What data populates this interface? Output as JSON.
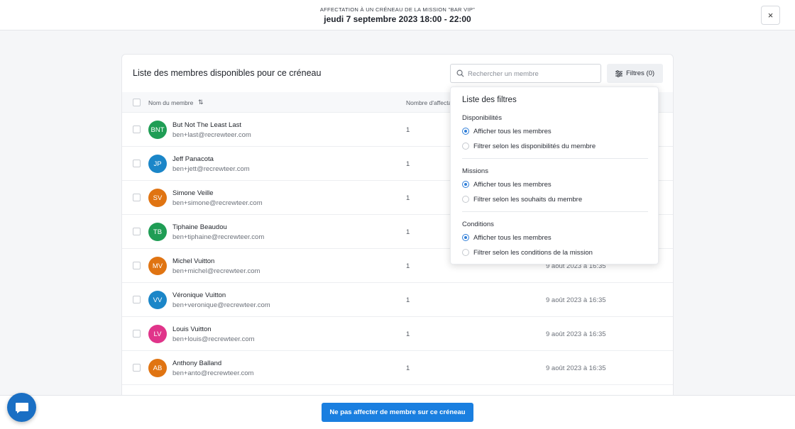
{
  "header": {
    "subtitle": "AFFECTATION À UN CRÉNEAU DE LA MISSION \"BAR VIP\"",
    "title": "jeudi 7 septembre 2023 18:00 - 22:00",
    "close_label": "×"
  },
  "panel": {
    "title": "Liste des membres disponibles pour ce créneau",
    "search_placeholder": "Rechercher un membre",
    "filters_label": "Filtres (0)"
  },
  "table": {
    "col_name": "Nom du membre",
    "col_count": "Nombre d'affecta",
    "sort_glyph": "⇅",
    "rows": [
      {
        "initials": "BNT",
        "color": "#1f9d55",
        "name": "But Not The Least Last",
        "email": "ben+last@recrewteer.com",
        "count": "1",
        "date": ""
      },
      {
        "initials": "JP",
        "color": "#1b86c8",
        "name": "Jeff Panacota",
        "email": "ben+jett@recrewteer.com",
        "count": "1",
        "date": ""
      },
      {
        "initials": "SV",
        "color": "#e07412",
        "name": "Simone Veille",
        "email": "ben+simone@recrewteer.com",
        "count": "1",
        "date": ""
      },
      {
        "initials": "TB",
        "color": "#1f9d55",
        "name": "Tiphaine Beaudou",
        "email": "ben+tiphaine@recrewteer.com",
        "count": "1",
        "date": ""
      },
      {
        "initials": "MV",
        "color": "#e07412",
        "name": "Michel Vuitton",
        "email": "ben+michel@recrewteer.com",
        "count": "1",
        "date": "9 août 2023 à 16:35"
      },
      {
        "initials": "VV",
        "color": "#1b86c8",
        "name": "Véronique Vuitton",
        "email": "ben+veronique@recrewteer.com",
        "count": "1",
        "date": "9 août 2023 à 16:35"
      },
      {
        "initials": "LV",
        "color": "#e0348a",
        "name": "Louis Vuitton",
        "email": "ben+louis@recrewteer.com",
        "count": "1",
        "date": "9 août 2023 à 16:35"
      },
      {
        "initials": "AB",
        "color": "#e07412",
        "name": "Anthony Balland",
        "email": "ben+anto@recrewteer.com",
        "count": "1",
        "date": "9 août 2023 à 16:35"
      }
    ]
  },
  "filters": {
    "title": "Liste des filtres",
    "sections": [
      {
        "label": "Disponibilités",
        "options": [
          "Afficher tous les membres",
          "Filtrer selon les disponibilités du membre"
        ],
        "selected": 0
      },
      {
        "label": "Missions",
        "options": [
          "Afficher tous les membres",
          "Filtrer selon les souhaits du membre"
        ],
        "selected": 0
      },
      {
        "label": "Conditions",
        "options": [
          "Afficher tous les membres",
          "Filtrer selon les conditions de la mission"
        ],
        "selected": 0
      }
    ]
  },
  "footer": {
    "button_label": "Ne pas affecter de membre sur ce créneau"
  },
  "icons": {
    "search": "search-icon",
    "filters": "sliders-icon",
    "chat": "chat-icon",
    "close": "close-icon"
  },
  "colors": {
    "primary": "#1a7fe0",
    "radio_selected": "#2f7ed8",
    "chat": "#1a6fc4"
  }
}
